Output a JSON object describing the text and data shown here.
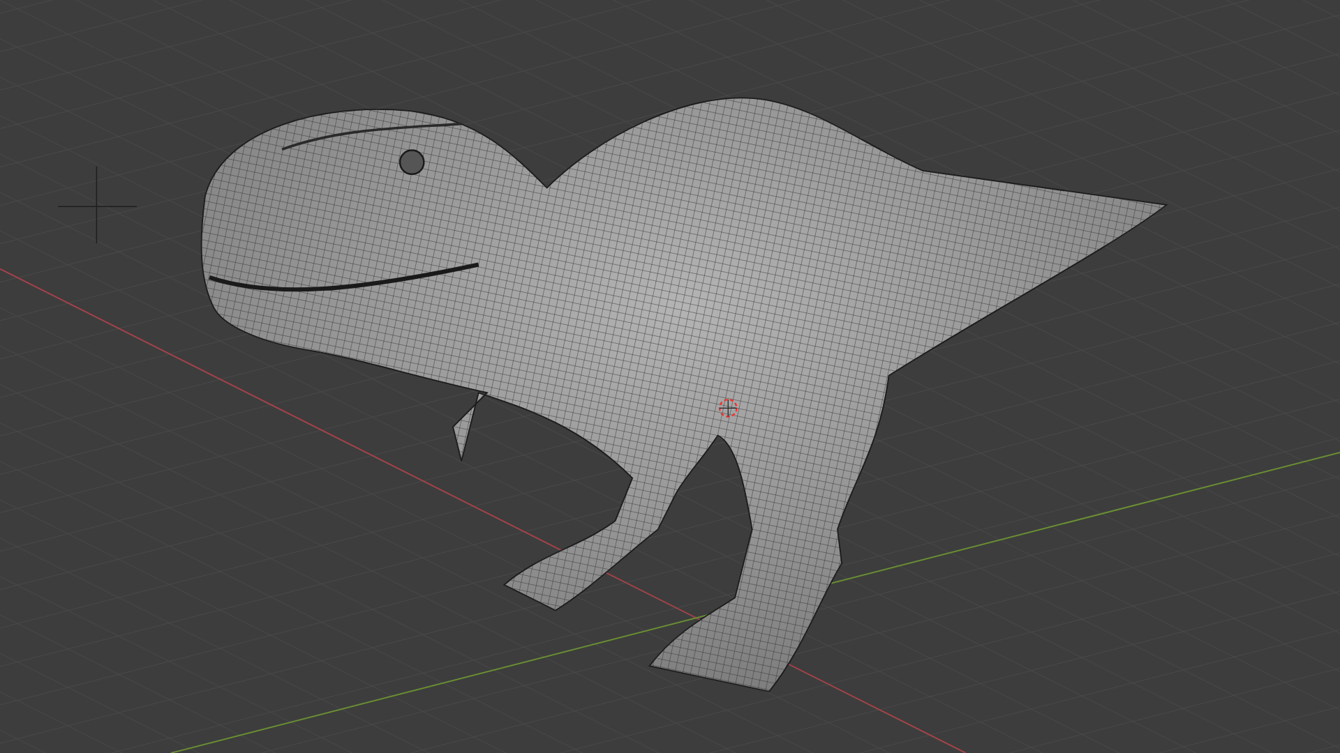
{
  "viewport": {
    "axes": [
      {
        "kind": "x",
        "color": "#a3434b"
      },
      {
        "kind": "y",
        "color": "#6a8f33"
      }
    ],
    "cursor_3d": true
  }
}
